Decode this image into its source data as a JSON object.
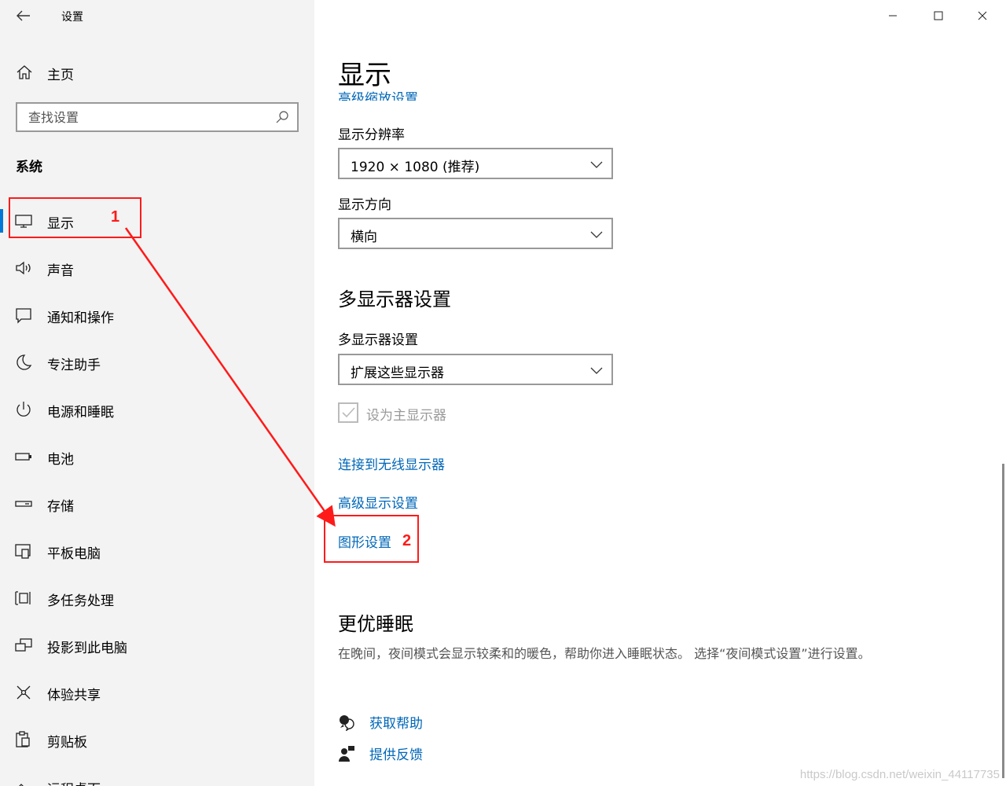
{
  "app": {
    "title": "设置"
  },
  "sidebar": {
    "home_label": "主页",
    "search_placeholder": "查找设置",
    "section_title": "系统",
    "items": [
      {
        "label": "显示",
        "icon": "monitor-icon"
      },
      {
        "label": "声音",
        "icon": "speaker-icon"
      },
      {
        "label": "通知和操作",
        "icon": "notification-icon"
      },
      {
        "label": "专注助手",
        "icon": "moon-icon"
      },
      {
        "label": "电源和睡眠",
        "icon": "power-icon"
      },
      {
        "label": "电池",
        "icon": "battery-icon"
      },
      {
        "label": "存储",
        "icon": "storage-icon"
      },
      {
        "label": "平板电脑",
        "icon": "tablet-icon"
      },
      {
        "label": "多任务处理",
        "icon": "multitask-icon"
      },
      {
        "label": "投影到此电脑",
        "icon": "project-icon"
      },
      {
        "label": "体验共享",
        "icon": "share-icon"
      },
      {
        "label": "剪贴板",
        "icon": "clipboard-icon"
      },
      {
        "label": "远程桌面",
        "icon": "remote-desktop-icon"
      }
    ]
  },
  "main": {
    "title": "显示",
    "clipped_link": "高级缩放设置",
    "resolution_label": "显示分辨率",
    "resolution_value": "1920 × 1080 (推荐)",
    "orientation_label": "显示方向",
    "orientation_value": "横向",
    "multi_heading": "多显示器设置",
    "multi_label": "多显示器设置",
    "multi_value": "扩展这些显示器",
    "make_main_label": "设为主显示器",
    "link_wireless": "连接到无线显示器",
    "link_advanced": "高级显示设置",
    "link_graphics": "图形设置",
    "sleep_heading": "更优睡眠",
    "sleep_desc": "在晚间，夜间模式会显示较柔和的暖色，帮助你进入睡眠状态。 选择“夜间模式设置”进行设置。",
    "help_label": "获取帮助",
    "feedback_label": "提供反馈"
  },
  "annotations": {
    "marker1": "1",
    "marker2": "2",
    "color": "#ff1a1a"
  },
  "watermark": "https://blog.csdn.net/weixin_44117735",
  "colors": {
    "accent": "#0078d7",
    "link": "#0067b8",
    "sidebar_bg": "#f3f3f3"
  }
}
